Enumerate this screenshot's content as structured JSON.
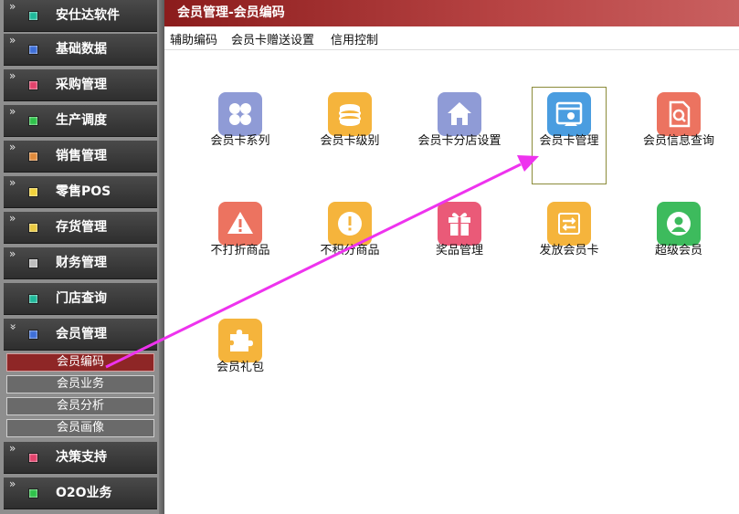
{
  "sidebar": {
    "items": [
      {
        "label": "安仕达软件",
        "icon": "teal-square-icon",
        "color": "#1fb89a"
      },
      {
        "label": "基础数据",
        "icon": "blue-square-icon",
        "color": "#3e6fd8"
      },
      {
        "label": "采购管理",
        "icon": "pink-square-icon",
        "color": "#e2426b"
      },
      {
        "label": "生产调度",
        "icon": "green-square-icon",
        "color": "#2fc24a"
      },
      {
        "label": "销售管理",
        "icon": "orange-square-icon",
        "color": "#e08a3a"
      },
      {
        "label": "零售POS",
        "icon": "yellow-square-icon",
        "color": "#f2d23a"
      },
      {
        "label": "存货管理",
        "icon": "yellow-square-icon",
        "color": "#e9c940"
      },
      {
        "label": "财务管理",
        "icon": "gray-square-icon",
        "color": "#bdbdbd"
      },
      {
        "label": "门店查询",
        "icon": "teal-square-icon",
        "color": "#1fb89a"
      },
      {
        "label": "会员管理",
        "icon": "blue-square-icon",
        "color": "#3e6fd8"
      },
      {
        "label": "决策支持",
        "icon": "pink-square-icon",
        "color": "#e2426b"
      },
      {
        "label": "O2O业务",
        "icon": "green-square-icon",
        "color": "#2fc24a"
      }
    ],
    "chevron_collapsed": "»",
    "chevron_expanded": "»",
    "subitems": [
      {
        "label": "会员编码",
        "active": true
      },
      {
        "label": "会员业务",
        "active": false
      },
      {
        "label": "会员分析",
        "active": false
      },
      {
        "label": "会员画像",
        "active": false
      }
    ]
  },
  "header": {
    "title": "会员管理-会员编码"
  },
  "toolbar": {
    "items": [
      "辅助编码",
      "会员卡赠送设置",
      "信用控制"
    ]
  },
  "tiles": [
    {
      "label": "会员卡系列",
      "icon": "grid-icon",
      "color": "#8f9bd6"
    },
    {
      "label": "会员卡级别",
      "icon": "coins-icon",
      "color": "#f5b43c"
    },
    {
      "label": "会员卡分店设置",
      "icon": "house-icon",
      "color": "#8f9bd6"
    },
    {
      "label": "会员卡管理",
      "icon": "member-card-icon",
      "color": "#4a9de0"
    },
    {
      "label": "会员信息查询",
      "icon": "document-search-icon",
      "color": "#ec7360"
    },
    {
      "label": "不打折商品",
      "icon": "warning-icon",
      "color": "#ec7360"
    },
    {
      "label": "不积分商品",
      "icon": "exclamation-icon",
      "color": "#f5b43c"
    },
    {
      "label": "奖品管理",
      "icon": "gift-icon",
      "color": "#ea5a78"
    },
    {
      "label": "发放会员卡",
      "icon": "exchange-icon",
      "color": "#f5b43c"
    },
    {
      "label": "超级会员",
      "icon": "user-icon",
      "color": "#3dbb5d"
    },
    {
      "label": "会员礼包",
      "icon": "puzzle-icon",
      "color": "#f5b43c"
    }
  ],
  "annotation": {
    "arrow_color": "#ee33ee"
  }
}
